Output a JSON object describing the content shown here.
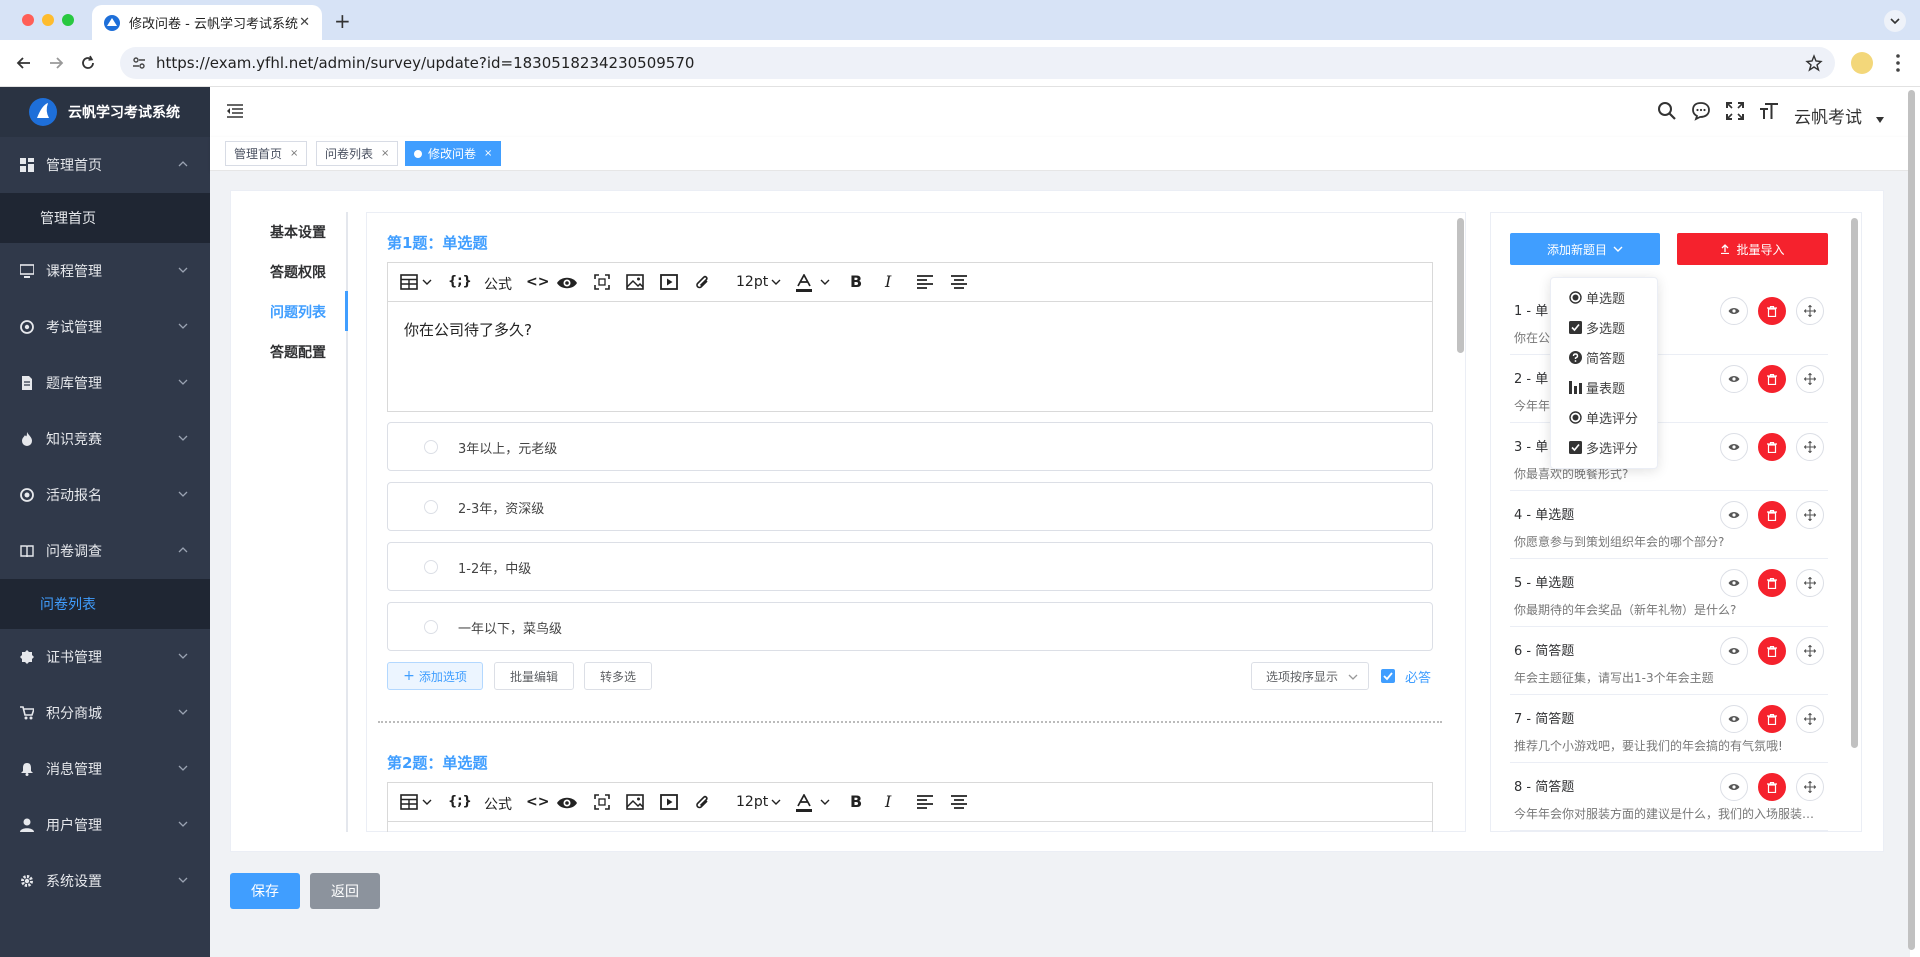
{
  "browser": {
    "tab_title": "修改问卷 - 云帆学习考试系统",
    "url": "https://exam.yfhl.net/admin/survey/update?id=1830518234230509570"
  },
  "sidebar": {
    "logo_text": "云帆学习考试系统",
    "items": [
      {
        "label": "管理首页",
        "icon": "dashboard-icon",
        "expanded": true
      },
      {
        "label": "课程管理",
        "icon": "monitor-icon"
      },
      {
        "label": "考试管理",
        "icon": "target-icon"
      },
      {
        "label": "题库管理",
        "icon": "document-icon"
      },
      {
        "label": "知识竞赛",
        "icon": "fire-icon"
      },
      {
        "label": "活动报名",
        "icon": "circle-icon"
      },
      {
        "label": "问卷调查",
        "icon": "book-icon",
        "expanded": true
      },
      {
        "label": "证书管理",
        "icon": "badge-icon"
      },
      {
        "label": "积分商城",
        "icon": "cart-icon"
      },
      {
        "label": "消息管理",
        "icon": "bell-icon"
      },
      {
        "label": "用户管理",
        "icon": "user-icon"
      },
      {
        "label": "系统设置",
        "icon": "gear-icon"
      }
    ],
    "sub_home": "管理首页",
    "sub_survey": "问卷列表"
  },
  "header": {
    "username": "云帆考试"
  },
  "tags": [
    {
      "label": "管理首页"
    },
    {
      "label": "问卷列表"
    },
    {
      "label": "修改问卷",
      "active": true
    }
  ],
  "left_nav": [
    "基本设置",
    "答题权限",
    "问题列表",
    "答题配置"
  ],
  "toolbar": {
    "formula": "公式",
    "font_size": "12pt"
  },
  "q1": {
    "title": "第1题：单选题",
    "content": "你在公司待了多久?",
    "options": [
      "3年以上，元老级",
      "2-3年，资深级",
      "1-2年，中级",
      "一年以下，菜鸟级"
    ],
    "add_option": "添加选项",
    "batch_edit": "批量编辑",
    "to_multi": "转多选",
    "order_select": "选项按序显示",
    "required": "必答"
  },
  "q2": {
    "title": "第2题：单选题"
  },
  "right": {
    "add_btn": "添加新题目",
    "import_btn": "批量导入",
    "questions": [
      {
        "title": "1 - 单",
        "desc": "你在公"
      },
      {
        "title": "2 - 单",
        "desc": "今年年"
      },
      {
        "title": "3 - 单",
        "desc": "你最喜欢的晚餐形式?"
      },
      {
        "title": "4 - 单选题",
        "desc": "你愿意参与到策划组织年会的哪个部分?"
      },
      {
        "title": "5 - 单选题",
        "desc": "你最期待的年会奖品（新年礼物）是什么?"
      },
      {
        "title": "6 - 简答题",
        "desc": "年会主题征集，请写出1-3个年会主题"
      },
      {
        "title": "7 - 简答题",
        "desc": "推荐几个小游戏吧，要让我们的年会搞的有气氛哦!"
      },
      {
        "title": "8 - 简答题",
        "desc": "今年年会你对服装方面的建议是什么，我们的入场服装…"
      }
    ],
    "dropdown": [
      "单选题",
      "多选题",
      "简答题",
      "量表题",
      "单选评分",
      "多选评分"
    ]
  },
  "footer": {
    "save": "保存",
    "back": "返回"
  },
  "colors": {
    "primary": "#409eff",
    "danger": "#f5222d",
    "sidebar": "#30394a"
  }
}
